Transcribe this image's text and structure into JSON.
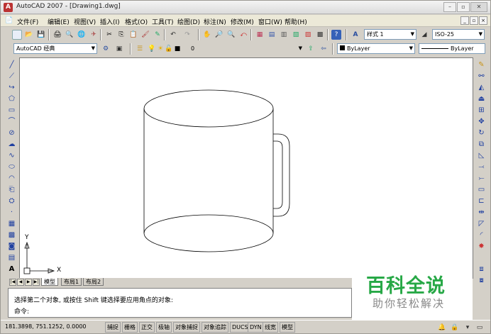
{
  "window": {
    "title": "AutoCAD 2007 - [Drawing1.dwg]",
    "app_icon": "autocad-logo-icon"
  },
  "menu": {
    "items": [
      "文件(F)",
      "编辑(E)",
      "视图(V)",
      "插入(I)",
      "格式(O)",
      "工具(T)",
      "绘图(D)",
      "标注(N)",
      "修改(M)",
      "窗口(W)",
      "帮助(H)"
    ]
  },
  "toolbar": {
    "text_style": "样式 1",
    "dim_style": "ISO-25",
    "workspace": "AutoCAD 经典",
    "layer": "0",
    "color": "ByLayer",
    "linetype": "ByLayer"
  },
  "tabs": [
    "模型",
    "布局1",
    "布局2"
  ],
  "command": {
    "history": "选择第二个对象, 或按住 Shift 键选择要应用角点的对象:",
    "prompt": "命令:"
  },
  "status": {
    "coords": "181.3898, 751.1252, 0.0000",
    "buttons": [
      "捕捉",
      "栅格",
      "正交",
      "极轴",
      "对象捕捉",
      "对象追踪",
      "DUCS",
      "DYN",
      "线宽",
      "模型"
    ]
  },
  "ucs": {
    "x_label": "X",
    "y_label": "Y"
  },
  "watermark": {
    "main": "百科全说",
    "sub": "助你轻松解决"
  },
  "colors": {
    "canvas": "#ffffff",
    "chrome": "#d4d0c8",
    "watermark_green": "#27a846"
  }
}
